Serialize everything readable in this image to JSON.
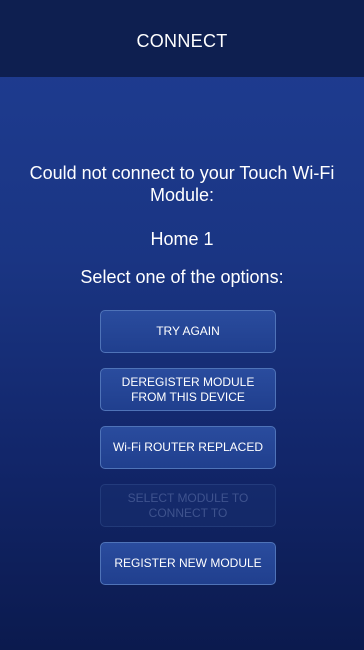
{
  "header": {
    "title": "CONNECT"
  },
  "message": {
    "line": "Could not connect to your Touch Wi-Fi Module:",
    "module_name": "Home 1",
    "instruction": "Select one of the options:"
  },
  "buttons": [
    {
      "label": "TRY AGAIN",
      "enabled": true
    },
    {
      "label": "DEREGISTER MODULE FROM THIS DEVICE",
      "enabled": true
    },
    {
      "label": "Wi-Fi ROUTER REPLACED",
      "enabled": true
    },
    {
      "label": "SELECT MODULE TO CONNECT TO",
      "enabled": false
    },
    {
      "label": "REGISTER NEW MODULE",
      "enabled": true
    }
  ],
  "colors": {
    "header_bg": "#0e1f50",
    "screen_gradient_top": "#1f3d93",
    "screen_gradient_bottom": "#0b1a4e",
    "button_border": "#4f73b8",
    "text": "#ffffff"
  }
}
